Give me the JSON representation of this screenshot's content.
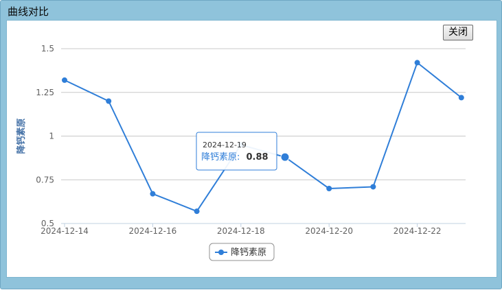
{
  "window": {
    "title": "曲线对比",
    "close_label": "关闭"
  },
  "chart_data": {
    "type": "line",
    "x": [
      "2024-12-14",
      "2024-12-15",
      "2024-12-16",
      "2024-12-17",
      "2024-12-18",
      "2024-12-19",
      "2024-12-20",
      "2024-12-21",
      "2024-12-22",
      "2024-12-23"
    ],
    "x_tick_labels": [
      "2024-12-14",
      "2024-12-16",
      "2024-12-18",
      "2024-12-20",
      "2024-12-22"
    ],
    "y_tick_labels": [
      "0.5",
      "0.75",
      "1",
      "1.25",
      "1.5"
    ],
    "ylim": [
      0.5,
      1.5
    ],
    "ylabel": "降钙素原",
    "grid": true,
    "legend": "bottom-center",
    "series": [
      {
        "name": "降钙素原",
        "color": "#2f7ed8",
        "values": [
          1.32,
          1.2,
          0.67,
          0.57,
          0.95,
          0.88,
          0.7,
          0.71,
          1.42,
          1.22
        ]
      }
    ],
    "tooltip": {
      "date": "2024-12-19",
      "series_label": "降钙素原:",
      "value": "0.88"
    }
  }
}
